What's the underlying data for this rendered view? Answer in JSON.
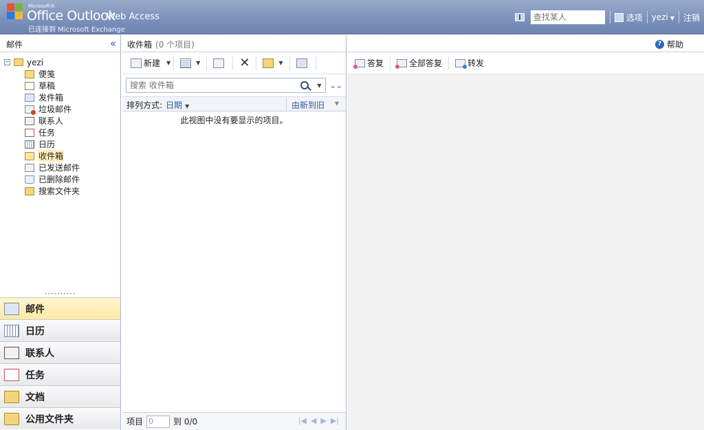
{
  "header": {
    "brand_microsoft": "Microsoft®",
    "brand_office": "Office Outlook",
    "brand_owa": "Web Access",
    "connected_text": "已连接到 Microsoft Exchange",
    "find_placeholder": "查找某人",
    "options_label": "选项",
    "user_label": "yezi",
    "logout_label": "注销"
  },
  "left": {
    "title": "邮件",
    "collapse_glyph": "«",
    "root_label": "yezi",
    "folders": [
      {
        "label": "便笺",
        "icon": "notes-icon"
      },
      {
        "label": "草稿",
        "icon": "drafts-icon"
      },
      {
        "label": "发件箱",
        "icon": "outbox-icon"
      },
      {
        "label": "垃圾邮件",
        "icon": "junk-icon"
      },
      {
        "label": "联系人",
        "icon": "contacts-icon"
      },
      {
        "label": "任务",
        "icon": "tasks-icon"
      },
      {
        "label": "日历",
        "icon": "calendar-icon"
      },
      {
        "label": "收件箱",
        "icon": "inbox-icon",
        "selected": true
      },
      {
        "label": "已发送邮件",
        "icon": "sent-icon"
      },
      {
        "label": "已删除邮件",
        "icon": "deleted-icon"
      },
      {
        "label": "搜索文件夹",
        "icon": "search-folder-icon"
      }
    ],
    "nav": [
      {
        "label": "邮件",
        "icon": "mail-icon",
        "active": true
      },
      {
        "label": "日历",
        "icon": "calendar-icon"
      },
      {
        "label": "联系人",
        "icon": "contacts-icon"
      },
      {
        "label": "任务",
        "icon": "tasks-icon"
      },
      {
        "label": "文档",
        "icon": "documents-icon"
      },
      {
        "label": "公用文件夹",
        "icon": "public-folder-icon"
      }
    ]
  },
  "middle": {
    "folder_title": "收件箱",
    "item_count": "(0 个项目)",
    "new_label": "新建",
    "search_placeholder": "搜索 收件箱",
    "sort_label": "排列方式:",
    "sort_by": "日期",
    "sort_order": "由新到旧",
    "empty_message": "此视图中没有要显示的项目。",
    "footer_items_label": "项目",
    "footer_page_value": "0",
    "footer_to_label": "到 0/0"
  },
  "right": {
    "help_label": "帮助",
    "reply_label": "答复",
    "reply_all_label": "全部答复",
    "forward_label": "转发"
  }
}
